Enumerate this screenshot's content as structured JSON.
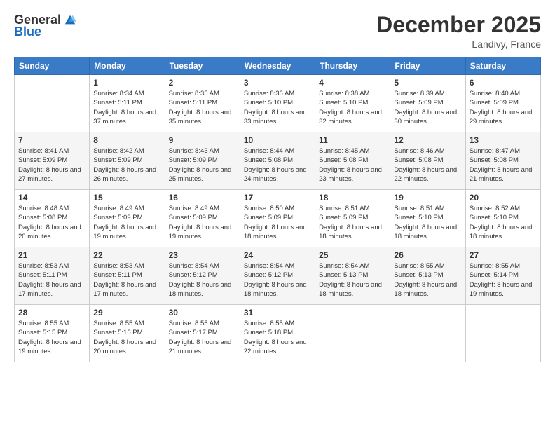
{
  "logo": {
    "general": "General",
    "blue": "Blue"
  },
  "header": {
    "month": "December 2025",
    "location": "Landivy, France"
  },
  "weekdays": [
    "Sunday",
    "Monday",
    "Tuesday",
    "Wednesday",
    "Thursday",
    "Friday",
    "Saturday"
  ],
  "weeks": [
    [
      {
        "day": "",
        "sunrise": "",
        "sunset": "",
        "daylight": ""
      },
      {
        "day": "1",
        "sunrise": "8:34 AM",
        "sunset": "5:11 PM",
        "daylight": "8 hours and 37 minutes."
      },
      {
        "day": "2",
        "sunrise": "8:35 AM",
        "sunset": "5:11 PM",
        "daylight": "8 hours and 35 minutes."
      },
      {
        "day": "3",
        "sunrise": "8:36 AM",
        "sunset": "5:10 PM",
        "daylight": "8 hours and 33 minutes."
      },
      {
        "day": "4",
        "sunrise": "8:38 AM",
        "sunset": "5:10 PM",
        "daylight": "8 hours and 32 minutes."
      },
      {
        "day": "5",
        "sunrise": "8:39 AM",
        "sunset": "5:09 PM",
        "daylight": "8 hours and 30 minutes."
      },
      {
        "day": "6",
        "sunrise": "8:40 AM",
        "sunset": "5:09 PM",
        "daylight": "8 hours and 29 minutes."
      }
    ],
    [
      {
        "day": "7",
        "sunrise": "8:41 AM",
        "sunset": "5:09 PM",
        "daylight": "8 hours and 27 minutes."
      },
      {
        "day": "8",
        "sunrise": "8:42 AM",
        "sunset": "5:09 PM",
        "daylight": "8 hours and 26 minutes."
      },
      {
        "day": "9",
        "sunrise": "8:43 AM",
        "sunset": "5:09 PM",
        "daylight": "8 hours and 25 minutes."
      },
      {
        "day": "10",
        "sunrise": "8:44 AM",
        "sunset": "5:08 PM",
        "daylight": "8 hours and 24 minutes."
      },
      {
        "day": "11",
        "sunrise": "8:45 AM",
        "sunset": "5:08 PM",
        "daylight": "8 hours and 23 minutes."
      },
      {
        "day": "12",
        "sunrise": "8:46 AM",
        "sunset": "5:08 PM",
        "daylight": "8 hours and 22 minutes."
      },
      {
        "day": "13",
        "sunrise": "8:47 AM",
        "sunset": "5:08 PM",
        "daylight": "8 hours and 21 minutes."
      }
    ],
    [
      {
        "day": "14",
        "sunrise": "8:48 AM",
        "sunset": "5:08 PM",
        "daylight": "8 hours and 20 minutes."
      },
      {
        "day": "15",
        "sunrise": "8:49 AM",
        "sunset": "5:09 PM",
        "daylight": "8 hours and 19 minutes."
      },
      {
        "day": "16",
        "sunrise": "8:49 AM",
        "sunset": "5:09 PM",
        "daylight": "8 hours and 19 minutes."
      },
      {
        "day": "17",
        "sunrise": "8:50 AM",
        "sunset": "5:09 PM",
        "daylight": "8 hours and 18 minutes."
      },
      {
        "day": "18",
        "sunrise": "8:51 AM",
        "sunset": "5:09 PM",
        "daylight": "8 hours and 18 minutes."
      },
      {
        "day": "19",
        "sunrise": "8:51 AM",
        "sunset": "5:10 PM",
        "daylight": "8 hours and 18 minutes."
      },
      {
        "day": "20",
        "sunrise": "8:52 AM",
        "sunset": "5:10 PM",
        "daylight": "8 hours and 18 minutes."
      }
    ],
    [
      {
        "day": "21",
        "sunrise": "8:53 AM",
        "sunset": "5:11 PM",
        "daylight": "8 hours and 17 minutes."
      },
      {
        "day": "22",
        "sunrise": "8:53 AM",
        "sunset": "5:11 PM",
        "daylight": "8 hours and 17 minutes."
      },
      {
        "day": "23",
        "sunrise": "8:54 AM",
        "sunset": "5:12 PM",
        "daylight": "8 hours and 18 minutes."
      },
      {
        "day": "24",
        "sunrise": "8:54 AM",
        "sunset": "5:12 PM",
        "daylight": "8 hours and 18 minutes."
      },
      {
        "day": "25",
        "sunrise": "8:54 AM",
        "sunset": "5:13 PM",
        "daylight": "8 hours and 18 minutes."
      },
      {
        "day": "26",
        "sunrise": "8:55 AM",
        "sunset": "5:13 PM",
        "daylight": "8 hours and 18 minutes."
      },
      {
        "day": "27",
        "sunrise": "8:55 AM",
        "sunset": "5:14 PM",
        "daylight": "8 hours and 19 minutes."
      }
    ],
    [
      {
        "day": "28",
        "sunrise": "8:55 AM",
        "sunset": "5:15 PM",
        "daylight": "8 hours and 19 minutes."
      },
      {
        "day": "29",
        "sunrise": "8:55 AM",
        "sunset": "5:16 PM",
        "daylight": "8 hours and 20 minutes."
      },
      {
        "day": "30",
        "sunrise": "8:55 AM",
        "sunset": "5:17 PM",
        "daylight": "8 hours and 21 minutes."
      },
      {
        "day": "31",
        "sunrise": "8:55 AM",
        "sunset": "5:18 PM",
        "daylight": "8 hours and 22 minutes."
      },
      {
        "day": "",
        "sunrise": "",
        "sunset": "",
        "daylight": ""
      },
      {
        "day": "",
        "sunrise": "",
        "sunset": "",
        "daylight": ""
      },
      {
        "day": "",
        "sunrise": "",
        "sunset": "",
        "daylight": ""
      }
    ]
  ],
  "labels": {
    "sunrise": "Sunrise:",
    "sunset": "Sunset:",
    "daylight": "Daylight: "
  }
}
